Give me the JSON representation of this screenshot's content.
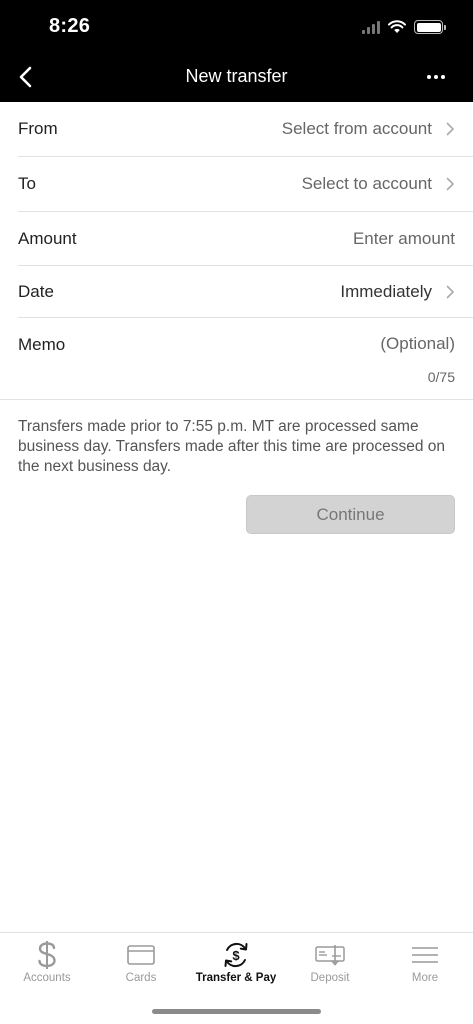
{
  "status_bar": {
    "time": "8:26"
  },
  "nav": {
    "title": "New transfer"
  },
  "form": {
    "from": {
      "label": "From",
      "value": "Select from account"
    },
    "to": {
      "label": "To",
      "value": "Select to account"
    },
    "amount": {
      "label": "Amount",
      "placeholder": "Enter amount"
    },
    "date": {
      "label": "Date",
      "value": "Immediately"
    },
    "memo": {
      "label": "Memo",
      "placeholder": "(Optional)",
      "counter": "0/75"
    }
  },
  "notice": "Transfers made prior to 7:55 p.m. MT are processed same business day. Transfers made after this time are processed on the next business day.",
  "continue_label": "Continue",
  "tabs": [
    {
      "label": "Accounts",
      "icon": "dollar-icon"
    },
    {
      "label": "Cards",
      "icon": "card-icon"
    },
    {
      "label": "Transfer & Pay",
      "icon": "transfer-icon",
      "active": true
    },
    {
      "label": "Deposit",
      "icon": "check-deposit-icon"
    },
    {
      "label": "More",
      "icon": "menu-icon"
    }
  ],
  "colors": {
    "header_bg": "#000000",
    "button_disabled": "#d3d3d3",
    "tab_inactive": "#9a9a9a"
  }
}
